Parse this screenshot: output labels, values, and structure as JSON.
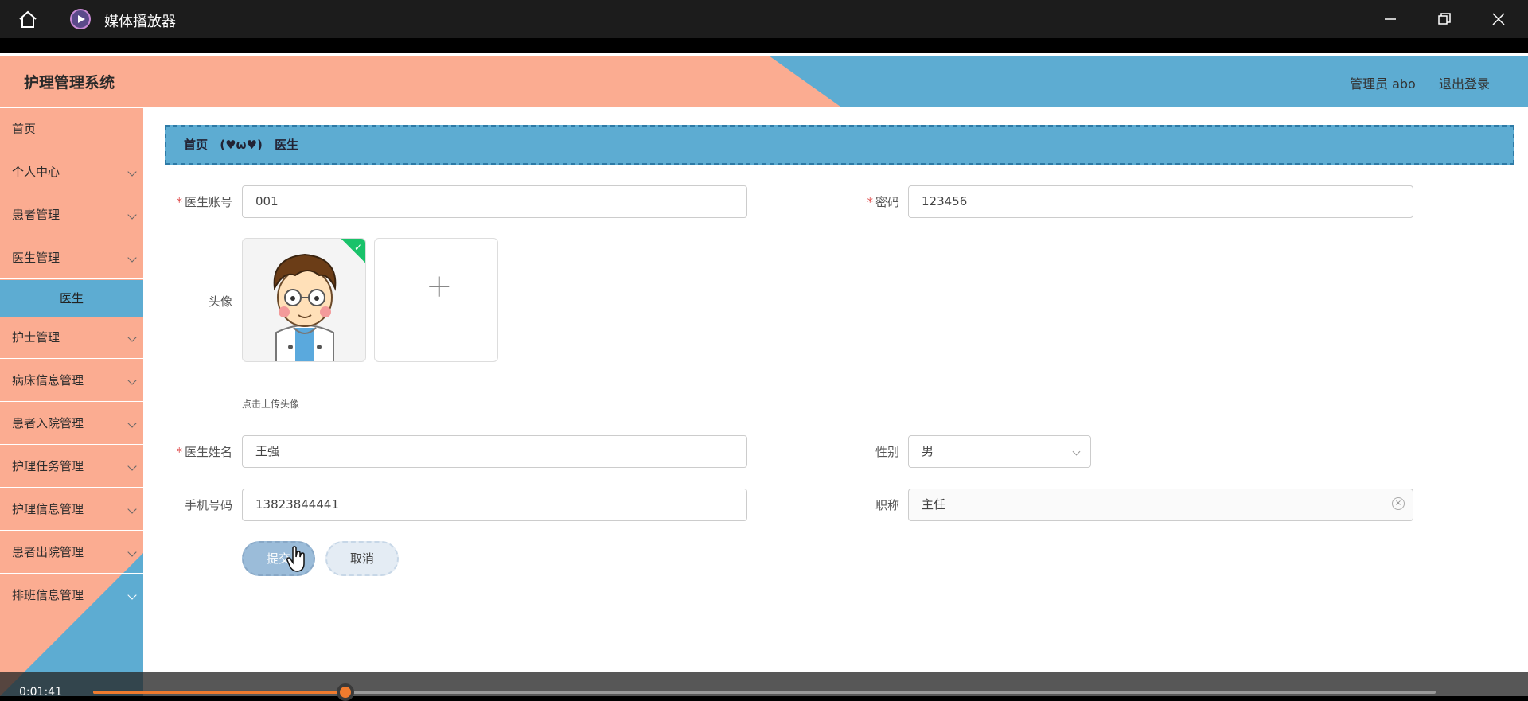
{
  "window": {
    "title": "媒体播放器"
  },
  "app": {
    "brand": "护理管理系统",
    "user": "管理员 abo",
    "logout": "退出登录"
  },
  "sidebar": {
    "items": [
      {
        "label": "首页",
        "has_chevron": false
      },
      {
        "label": "个人中心",
        "has_chevron": true
      },
      {
        "label": "患者管理",
        "has_chevron": true
      },
      {
        "label": "医生管理",
        "has_chevron": true
      },
      {
        "label": "护士管理",
        "has_chevron": true
      },
      {
        "label": "病床信息管理",
        "has_chevron": true
      },
      {
        "label": "患者入院管理",
        "has_chevron": true
      },
      {
        "label": "护理任务管理",
        "has_chevron": true
      },
      {
        "label": "护理信息管理",
        "has_chevron": true
      },
      {
        "label": "患者出院管理",
        "has_chevron": true
      },
      {
        "label": "排班信息管理",
        "has_chevron": true
      }
    ],
    "sub_item": "医生"
  },
  "breadcrumb": {
    "home": "首页",
    "separator": "(♥ω♥)",
    "current": "医生"
  },
  "form": {
    "account_label": "医生账号",
    "account_value": "001",
    "password_label": "密码",
    "password_value": "123456",
    "avatar_label": "头像",
    "avatar_hint": "点击上传头像",
    "upload_plus": "+",
    "name_label": "医生姓名",
    "name_value": "王强",
    "gender_label": "性别",
    "gender_value": "男",
    "phone_label": "手机号码",
    "phone_value": "13823844441",
    "title_label": "职称",
    "title_value": "主任",
    "required_mark": "*",
    "submit": "提交",
    "cancel": "取消"
  },
  "player": {
    "time": "0:01:41",
    "progress": 0.188
  },
  "colors": {
    "salmon": "#fbac91",
    "blue": "#5dacd2",
    "progress": "#f07b2e"
  }
}
